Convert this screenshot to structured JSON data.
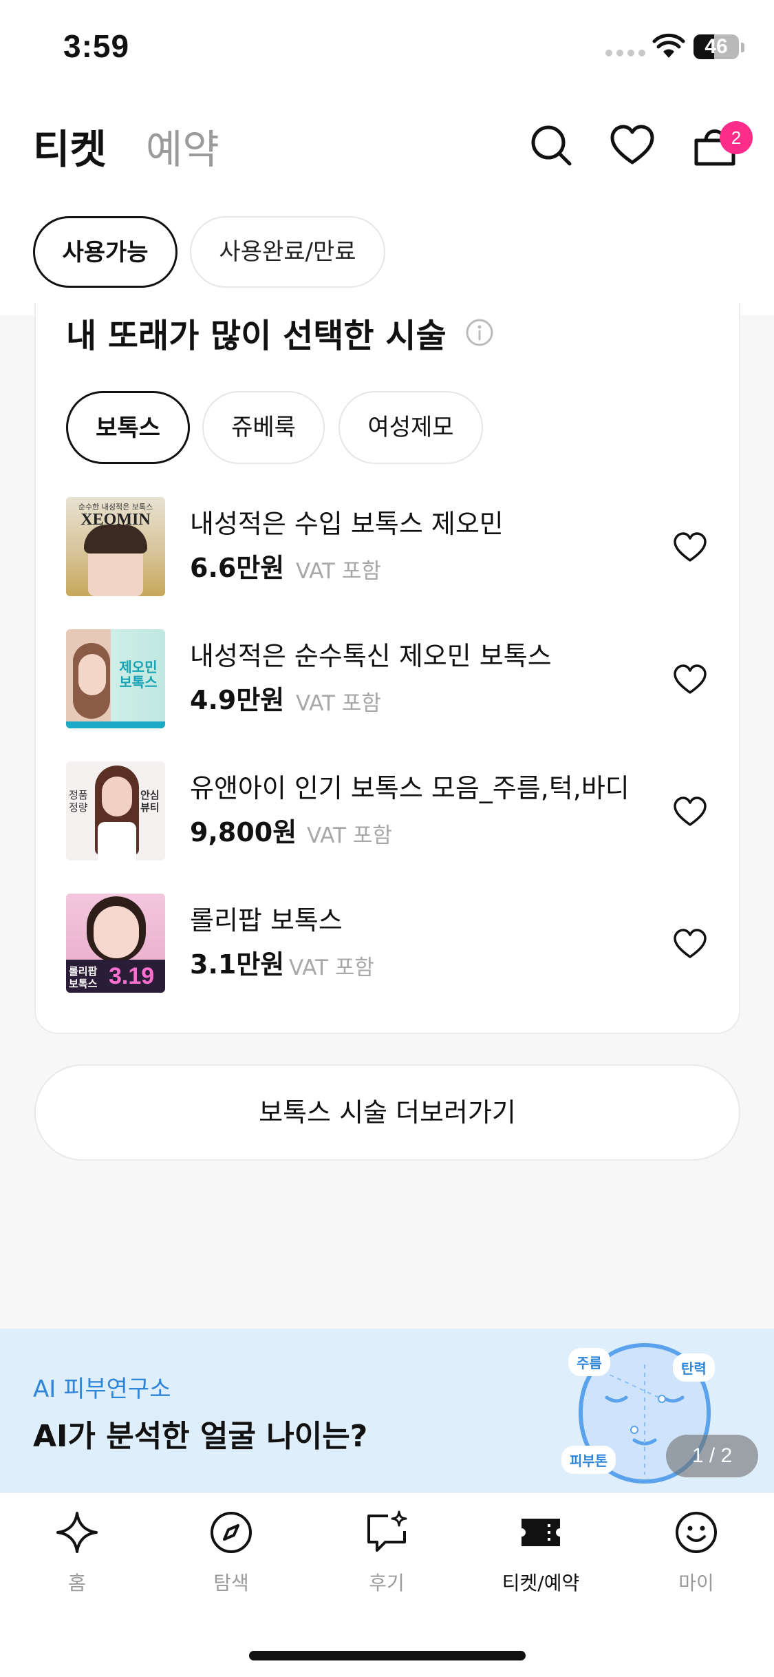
{
  "status_bar": {
    "time": "3:59",
    "battery": "46",
    "battery_level": 0.46
  },
  "header": {
    "tabs": [
      {
        "label": "티켓",
        "active": true
      },
      {
        "label": "예약",
        "active": false
      }
    ],
    "icons": [
      "search-icon",
      "heart-icon",
      "shopping-bag-icon"
    ],
    "cart_count": "2"
  },
  "filters": {
    "available": "사용가능",
    "used_expired": "사용완료/만료"
  },
  "section": {
    "title": "내 또래가 많이 선택한 시술",
    "categories": [
      {
        "label": "보톡스",
        "selected": true
      },
      {
        "label": "쥬베룩",
        "selected": false
      },
      {
        "label": "여성제모",
        "selected": false
      }
    ],
    "items": [
      {
        "name": "내성적은 수입 보톡스 제오민",
        "price": "6.6만원",
        "vat": "VAT 포함",
        "thumb_text_top": "순수한 내성적은 보톡스",
        "thumb_text_main": "XEOMIN"
      },
      {
        "name": "내성적은 순수톡신 제오민 보톡스",
        "price": "4.9만원",
        "vat": "VAT 포함",
        "thumb_text_main": "제오민 보톡스"
      },
      {
        "name": "유앤아이 인기 보톡스 모음_주름,턱,바디",
        "price": "9,800원",
        "vat": "VAT 포함",
        "thumb_text_left": "정품 정량",
        "thumb_text_right": "안심 뷰티"
      },
      {
        "name": "롤리팝 보톡스",
        "price": "3.1만원",
        "vat": "VAT 포함",
        "thumb_text_main": "롤리팝 보톡스",
        "thumb_text_price": "3.19"
      }
    ],
    "more_button": "보톡스 시술 더보러가기"
  },
  "banner": {
    "subtitle": "AI 피부연구소",
    "title": "AI가 분석한 얼굴 나이는?",
    "tags": [
      "주름",
      "탄력",
      "피부톤"
    ],
    "pager": "1 / 2"
  },
  "nav": {
    "items": [
      {
        "label": "홈",
        "icon": "sparkle-icon",
        "active": false
      },
      {
        "label": "탐색",
        "icon": "compass-icon",
        "active": false
      },
      {
        "label": "후기",
        "icon": "review-icon",
        "active": false
      },
      {
        "label": "티켓/예약",
        "icon": "ticket-icon",
        "active": true
      },
      {
        "label": "마이",
        "icon": "smiley-icon",
        "active": false
      }
    ]
  },
  "colors": {
    "accent_pink": "#ff2d8a",
    "banner_bg": "#deeefb",
    "banner_blue": "#2f86d9",
    "muted": "#9a9a9a"
  }
}
